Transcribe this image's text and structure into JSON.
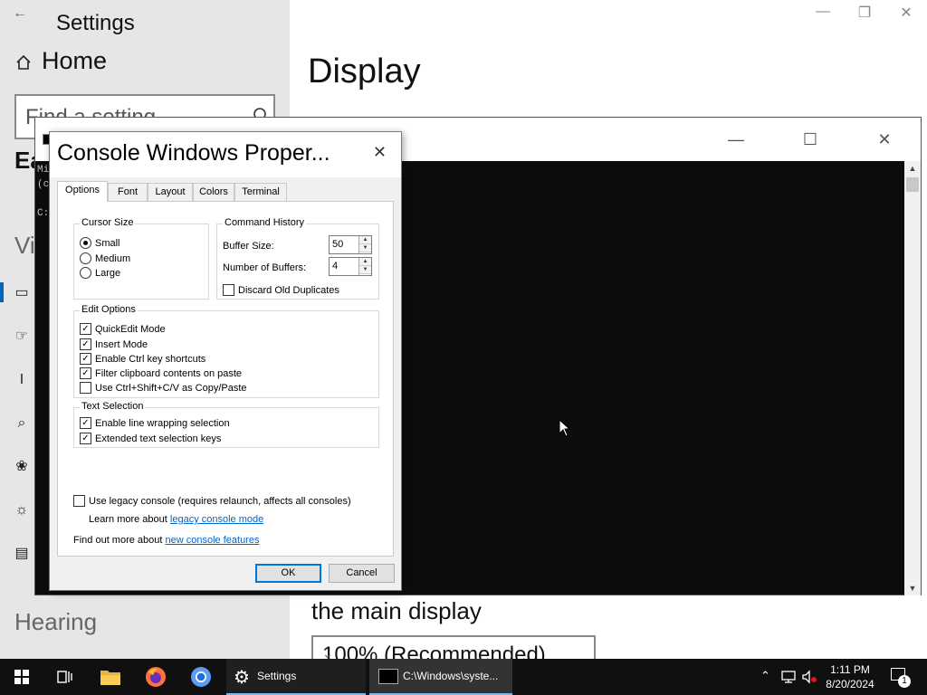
{
  "settings": {
    "window_title": "Settings",
    "home_label": "Home",
    "search_placeholder": "Find a setting",
    "section_partial": "Ea",
    "vision_partial": "Vi",
    "hearing_label": "Hearing",
    "page_title": "Display",
    "main_display_text": "the main display",
    "scale_value": "100% (Recommended)"
  },
  "console": {
    "line1": "Mi",
    "line2": "(c",
    "line3": "C:"
  },
  "dialog": {
    "title": "Console Windows Proper...",
    "tabs": [
      "Options",
      "Font",
      "Layout",
      "Colors",
      "Terminal"
    ],
    "cursor_size": {
      "label": "Cursor Size",
      "options": [
        "Small",
        "Medium",
        "Large"
      ],
      "selected": "Small"
    },
    "command_history": {
      "label": "Command History",
      "buffer_size_label": "Buffer Size:",
      "buffer_size_value": "50",
      "num_buffers_label": "Number of Buffers:",
      "num_buffers_value": "4",
      "discard_label": "Discard Old Duplicates"
    },
    "edit_options": {
      "label": "Edit Options",
      "items": [
        {
          "label": "QuickEdit Mode",
          "checked": true
        },
        {
          "label": "Insert Mode",
          "checked": true
        },
        {
          "label": "Enable Ctrl key shortcuts",
          "checked": true
        },
        {
          "label": "Filter clipboard contents on paste",
          "checked": true
        },
        {
          "label": "Use Ctrl+Shift+C/V as Copy/Paste",
          "checked": false
        }
      ]
    },
    "text_selection": {
      "label": "Text Selection",
      "items": [
        {
          "label": "Enable line wrapping selection",
          "checked": true
        },
        {
          "label": "Extended text selection keys",
          "checked": true
        }
      ]
    },
    "legacy_label": "Use legacy console (requires relaunch, affects all consoles)",
    "learn_more_prefix": "Learn more about ",
    "learn_more_link": "legacy console mode",
    "find_out_prefix": "Find out more about ",
    "find_out_link": "new console features",
    "ok_label": "OK",
    "cancel_label": "Cancel"
  },
  "taskbar": {
    "settings_label": "Settings",
    "console_label": "C:\\Windows\\syste...",
    "time": "1:11 PM",
    "date": "8/20/2024",
    "notification_count": "1"
  },
  "colors": {
    "accent": "#0078d7",
    "taskbar": "#101010",
    "console_bg": "#0c0c0c",
    "link": "#0066cc"
  }
}
